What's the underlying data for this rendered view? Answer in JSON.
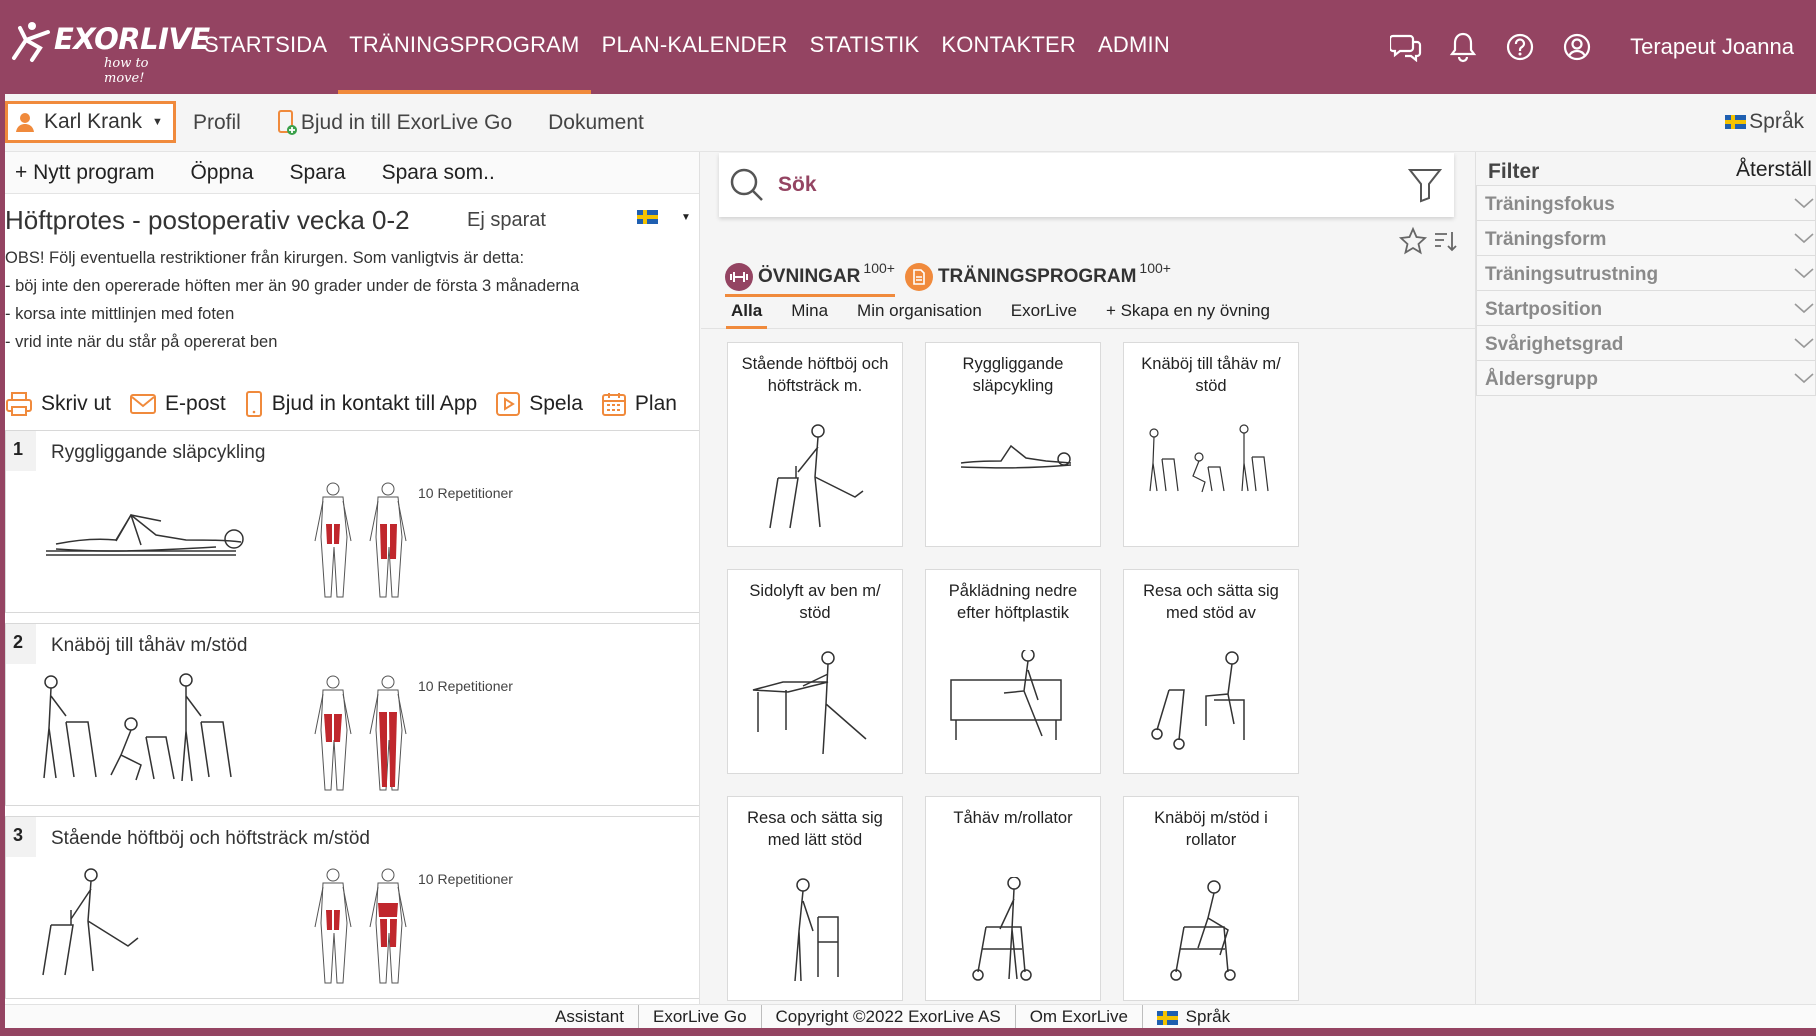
{
  "app": {
    "brand": "EXORLIVE",
    "tagline": "how to move!"
  },
  "colors": {
    "brand": "#944462",
    "accent": "#f08a3c",
    "muscle": "#c0272d"
  },
  "nav": {
    "items": [
      {
        "label": "STARTSIDA",
        "active": false
      },
      {
        "label": "TRÄNINGSPROGRAM",
        "active": true
      },
      {
        "label": "PLAN-KALENDER",
        "active": false
      },
      {
        "label": "STATISTIK",
        "active": false
      },
      {
        "label": "KONTAKTER",
        "active": false
      },
      {
        "label": "ADMIN",
        "active": false
      }
    ],
    "icons": [
      "chat-icon",
      "bell-icon",
      "help-icon",
      "user-circle-icon"
    ],
    "user": "Terapeut Joanna"
  },
  "subbar": {
    "client": "Karl Krank",
    "profile": "Profil",
    "invite": "Bjud in till ExorLive Go",
    "documents": "Dokument",
    "language": "Språk"
  },
  "program_toolbar": {
    "new": "+ Nytt program",
    "open": "Öppna",
    "save": "Spara",
    "save_as": "Spara som.."
  },
  "program": {
    "title": "Höftprotes - postoperativ vecka 0-2",
    "status": "Ej sparat",
    "notes": [
      "OBS! Följ eventuella restriktioner från kirurgen. Som vanligtvis är detta:",
      "- böj inte den opererade höften mer än 90 grader under de första 3 månaderna",
      "- korsa inte mittlinjen med foten",
      "- vrid inte när du står på opererat ben"
    ]
  },
  "actions": {
    "print": "Skriv ut",
    "email": "E-post",
    "invite_app": "Bjud in kontakt till App",
    "play": "Spela",
    "plan": "Plan"
  },
  "program_exercises": [
    {
      "num": "1",
      "name": "Ryggliggande släpcykling",
      "reps": "10 Repetitioner"
    },
    {
      "num": "2",
      "name": "Knäböj till tåhäv m/stöd",
      "reps": "10 Repetitioner"
    },
    {
      "num": "3",
      "name": "Stående höftböj och höftsträck m/stöd",
      "reps": "10 Repetitioner"
    }
  ],
  "search": {
    "placeholder": "Sök"
  },
  "tabs": [
    {
      "label": "ÖVNINGAR",
      "count": "100+",
      "active": true
    },
    {
      "label": "TRÄNINGSPROGRAM",
      "count": "100+",
      "active": false
    }
  ],
  "subtabs": [
    {
      "label": "Alla",
      "active": true
    },
    {
      "label": "Mina",
      "active": false
    },
    {
      "label": "Min organisation",
      "active": false
    },
    {
      "label": "ExorLive",
      "active": false
    },
    {
      "label": "+ Skapa en ny övning",
      "active": false
    }
  ],
  "exercises": [
    {
      "name": "Stående höftböj och höftsträck m."
    },
    {
      "name": "Ryggliggande släpcykling"
    },
    {
      "name": "Knäböj till tåhäv m/ stöd"
    },
    {
      "name": "Sidolyft av ben m/ stöd"
    },
    {
      "name": "Påklädning nedre efter höftplastik"
    },
    {
      "name": "Resa och sätta sig med stöd av"
    },
    {
      "name": "Resa och sätta sig med lätt stöd"
    },
    {
      "name": "Tåhäv m/rollator"
    },
    {
      "name": "Knäböj m/stöd i rollator"
    }
  ],
  "filter": {
    "title": "Filter",
    "reset": "Återställ",
    "facets": [
      "Träningsfokus",
      "Träningsform",
      "Träningsutrustning",
      "Startposition",
      "Svårighetsgrad",
      "Åldersgrupp"
    ]
  },
  "footer": {
    "assistant": "Assistant",
    "go": "ExorLive Go",
    "copyright": "Copyright ©2022 ExorLive AS",
    "about": "Om ExorLive",
    "language": "Språk"
  }
}
